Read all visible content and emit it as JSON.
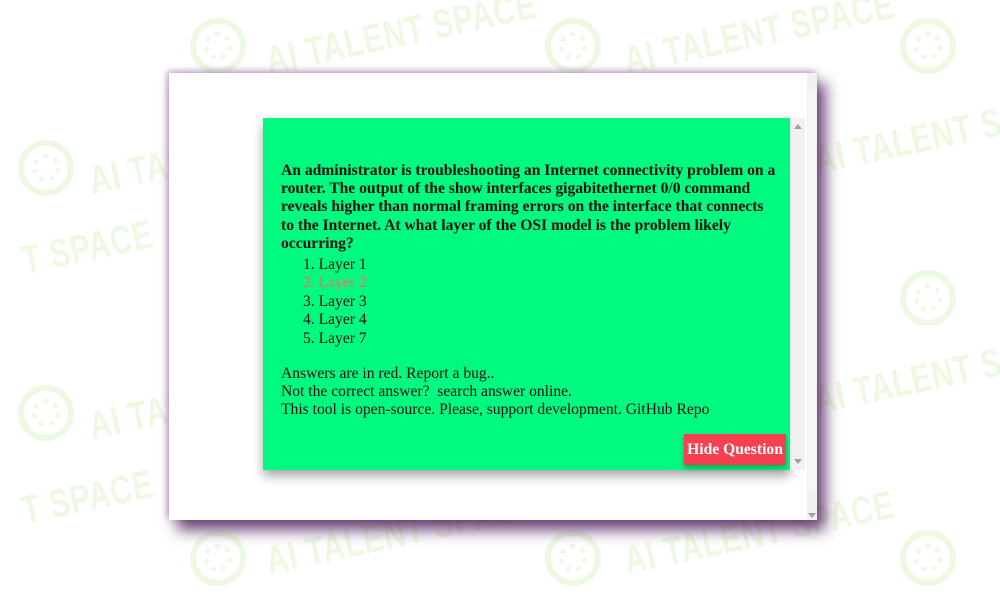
{
  "watermark": {
    "text_1": "AI TALENT SPACE",
    "text_2": "AI TALENT SPACE",
    "text_3": "AI TALENT SPACE",
    "text_4": "AI TALENT SPACE",
    "text_5": "AI TALENT SPACE",
    "text_6": "AI TALENT SPACE",
    "text_7": "AI TALENT SPACE",
    "text_8": "T SPACE",
    "text_9": "T SPACE",
    "text_10": "AI TALENT SPACE",
    "text_11": "AI TALENT SPACE",
    "logo_icon": "brain-circle-logo",
    "color": "#eef9e3"
  },
  "question": {
    "text": "An administrator is troubleshooting an Internet connectivity problem on a router. The output of the show interfaces gigabitethernet 0/0 command reveals higher than normal framing errors on the interface that connects to the Internet. At what layer of the OSI model is the problem likely occurring?",
    "options": [
      {
        "label": "1. Layer 1",
        "correct": false
      },
      {
        "label": "2. Layer 2",
        "correct": true
      },
      {
        "label": "3. Layer 3",
        "correct": false
      },
      {
        "label": "4. Layer 4",
        "correct": false
      },
      {
        "label": "5. Layer 7",
        "correct": false
      }
    ]
  },
  "footer": {
    "answers_note": "Answers are in red.",
    "report_link": "Report a bug..",
    "not_correct": "Not the correct answer?",
    "search_link": "search answer online.",
    "open_source": "This tool is open-source.",
    "support_link": "Please, support development.",
    "github_link": "GitHub Repo"
  },
  "actions": {
    "hide_question_label": "Hide Question"
  },
  "colors": {
    "card_background": "#00fa7f",
    "correct_answer": "#ff6a6a",
    "hide_button": "#f5404f",
    "frame_glow": "#501e5a"
  }
}
